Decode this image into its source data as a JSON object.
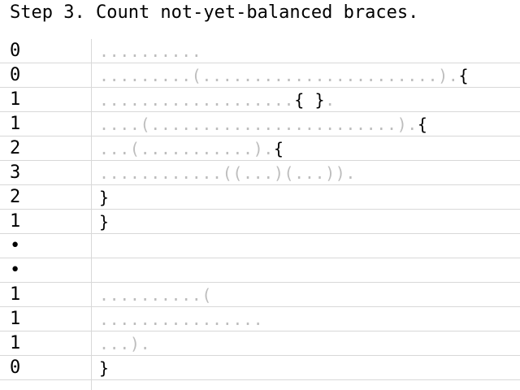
{
  "title": "Step 3. Count not-yet-balanced braces.",
  "rows": [
    {
      "count": "0",
      "faded": "..........",
      "strong": ""
    },
    {
      "count": "0",
      "faded": ".........(.......................).",
      "strong": "{"
    },
    {
      "count": "1",
      "faded": "...................",
      "strong": "{ }",
      "tail": "."
    },
    {
      "count": "1",
      "faded": "....(........................).",
      "strong": "{"
    },
    {
      "count": "2",
      "faded": "...(...........).",
      "strong": "{"
    },
    {
      "count": "3",
      "faded": "............((...)(...)).",
      "strong": ""
    },
    {
      "count": "2",
      "faded": "",
      "strong": "}"
    },
    {
      "count": "1",
      "faded": "",
      "strong": "}"
    },
    {
      "count": "•",
      "faded": "",
      "strong": ""
    },
    {
      "count": "•",
      "faded": "",
      "strong": ""
    },
    {
      "count": "1",
      "faded": "..........(",
      "strong": ""
    },
    {
      "count": "1",
      "faded": "................",
      "strong": ""
    },
    {
      "count": "1",
      "faded": "...).",
      "strong": ""
    },
    {
      "count": "0",
      "faded": "",
      "strong": "}"
    }
  ]
}
